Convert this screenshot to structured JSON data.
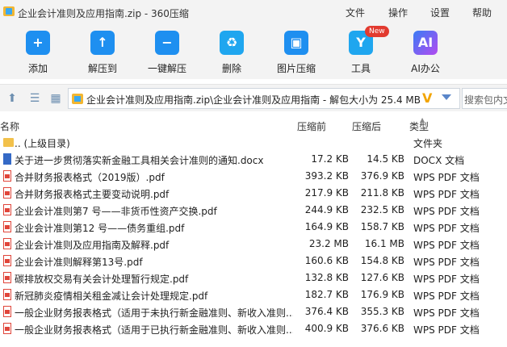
{
  "window": {
    "title": "企业会计准则及应用指南.zip - 360压缩"
  },
  "menu": {
    "file": "文件",
    "ops": "操作",
    "settings": "设置",
    "help": "帮助"
  },
  "toolbar": {
    "add": "添加",
    "extract_to": "解压到",
    "one_click": "一键解压",
    "delete": "删除",
    "image_compress": "图片压缩",
    "tools": "工具",
    "tools_badge": "New",
    "ai_office": "AI办公",
    "ai_glyph": "AI"
  },
  "address": {
    "path": "企业会计准则及应用指南.zip\\企业会计准则及应用指南 - 解包大小为 25.4 MB",
    "search_placeholder": "搜索包内文"
  },
  "columns": {
    "name": "名称",
    "size": "压缩前",
    "packed": "压缩后",
    "type": "类型"
  },
  "files": [
    {
      "icon": "folder",
      "name": ".. (上级目录)",
      "size": "",
      "packed": "",
      "type": "文件夹"
    },
    {
      "icon": "docx",
      "name": "关于进一步贯彻落实新金融工具相关会计准则的通知.docx",
      "size": "17.2 KB",
      "packed": "14.5 KB",
      "type": "DOCX 文档"
    },
    {
      "icon": "pdf",
      "name": "合并财务报表格式（2019版）.pdf",
      "size": "393.2 KB",
      "packed": "376.9 KB",
      "type": "WPS PDF 文档"
    },
    {
      "icon": "pdf",
      "name": "合并财务报表格式主要变动说明.pdf",
      "size": "217.9 KB",
      "packed": "211.8 KB",
      "type": "WPS PDF 文档"
    },
    {
      "icon": "pdf",
      "name": "企业会计准则第7 号——非货币性资产交换.pdf",
      "size": "244.9 KB",
      "packed": "232.5 KB",
      "type": "WPS PDF 文档"
    },
    {
      "icon": "pdf",
      "name": "企业会计准则第12 号——债务重组.pdf",
      "size": "164.9 KB",
      "packed": "158.7 KB",
      "type": "WPS PDF 文档"
    },
    {
      "icon": "pdf",
      "name": "企业会计准则及应用指南及解释.pdf",
      "size": "23.2 MB",
      "packed": "16.1 MB",
      "type": "WPS PDF 文档"
    },
    {
      "icon": "pdf",
      "name": "企业会计准则解释第13号.pdf",
      "size": "160.6 KB",
      "packed": "154.8 KB",
      "type": "WPS PDF 文档"
    },
    {
      "icon": "pdf",
      "name": "碳排放权交易有关会计处理暂行规定.pdf",
      "size": "132.8 KB",
      "packed": "127.6 KB",
      "type": "WPS PDF 文档"
    },
    {
      "icon": "pdf",
      "name": "新冠肺炎疫情相关租金减让会计处理规定.pdf",
      "size": "182.7 KB",
      "packed": "176.9 KB",
      "type": "WPS PDF 文档"
    },
    {
      "icon": "pdf",
      "name": "一般企业财务报表格式（适用于未执行新金融准则、新收入准则...",
      "size": "376.4 KB",
      "packed": "355.3 KB",
      "type": "WPS PDF 文档"
    },
    {
      "icon": "pdf",
      "name": "一般企业财务报表格式（适用于已执行新金融准则、新收入准则...",
      "size": "400.9 KB",
      "packed": "376.6 KB",
      "type": "WPS PDF 文档"
    }
  ]
}
